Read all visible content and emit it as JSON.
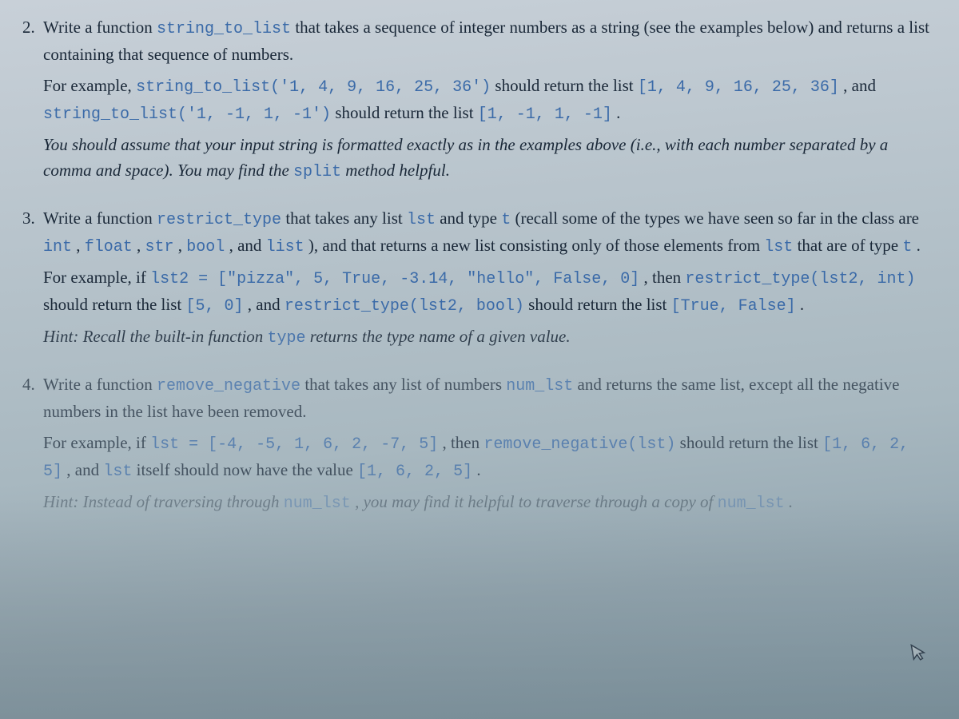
{
  "q2": {
    "num": "2.",
    "line1a": "Write a function ",
    "fn": "string_to_list",
    "line1b": " that takes a sequence of integer numbers as a string (see the examples below) and returns a list containing that sequence of numbers.",
    "ex1a": "For example, ",
    "ex1code": "string_to_list('1, 4, 9, 16, 25, 36')",
    "ex1b": " should return the list ",
    "ex1res": "[1, 4, 9, 16, 25, 36]",
    "ex1c": " , and ",
    "ex2code": "string_to_list('1, -1, 1, -1')",
    "ex2b": " should return the list ",
    "ex2res": "[1, -1, 1, -1]",
    "ex2c": " .",
    "hint1": "You should assume that your input string is formatted exactly as in the examples above (i.e., with each number separated by a comma and space).  You may find the ",
    "hintcode": "split",
    "hint2": " method helpful."
  },
  "q3": {
    "num": "3.",
    "l1a": "Write a function ",
    "fn": "restrict_type",
    "l1b": " that takes any list ",
    "lst": "lst",
    "l1c": " and type ",
    "t": "t",
    "l1d": " (recall some of the types we have seen so far in the class are ",
    "ty1": "int",
    "c1": " , ",
    "ty2": "float",
    "c2": " , ",
    "ty3": "str",
    "c3": " , ",
    "ty4": "bool",
    "c4": " , and ",
    "ty5": "list",
    "c5": " ), and that returns a new list consisting only of those elements from ",
    "lst2": "lst",
    "l1e": " that are of type ",
    "t2": "t",
    "l1f": " .",
    "ex1a": "For example, if ",
    "ex1code": "lst2 = [\"pizza\", 5, True, -3.14, \"hello\", False, 0]",
    "ex1b": " , then ",
    "ex2code": "restrict_type(lst2, int)",
    "ex2b": " should return the list ",
    "ex2res": "[5, 0]",
    "ex2c": " , and ",
    "ex3code": "restrict_type(lst2, bool)",
    "ex3b": " should return the list ",
    "ex3res": "[True, False]",
    "ex3c": " .",
    "hinta": "Hint: Recall the built-in function ",
    "hintcode": "type",
    "hintb": " returns the type name of a given value."
  },
  "q4": {
    "num": "4.",
    "l1a": "Write a function ",
    "fn": "remove_negative",
    "l1b": " that takes any list of numbers ",
    "nl": "num_lst",
    "l1c": " and returns the same list, except all the negative numbers in the list have been removed.",
    "ex1a": "For example, if ",
    "ex1code": "lst = [-4, -5, 1, 6, 2, -7, 5]",
    "ex1b": " , then ",
    "ex2code": "remove_negative(lst)",
    "ex2b": " should return the list ",
    "ex2res": "[1, 6, 2, 5]",
    "ex2c": " , and ",
    "ex3code": "lst",
    "ex3b": " itself should now have the value ",
    "ex3res": "[1, 6, 2, 5]",
    "ex3c": " .",
    "hinta": "Hint: Instead of traversing through ",
    "hintcode1": "num_lst",
    "hintb": " , you may find it helpful to traverse through a copy of ",
    "hintcode2": "num_lst",
    "hintc": " ."
  }
}
